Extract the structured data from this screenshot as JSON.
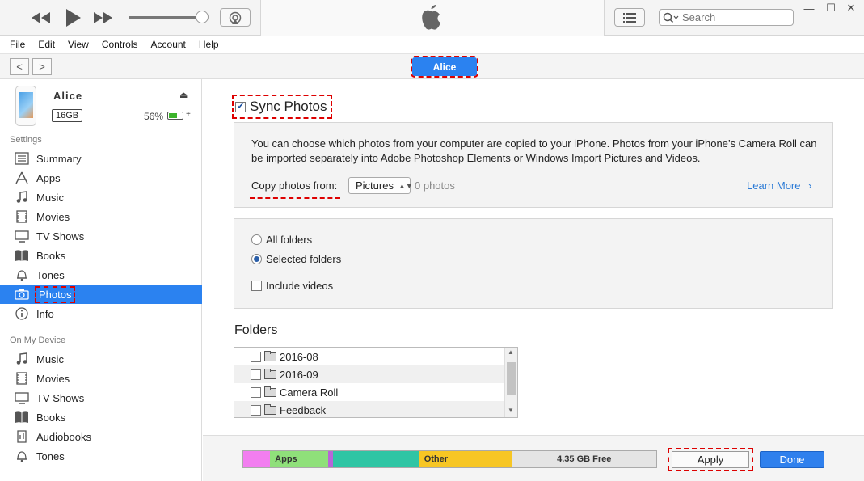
{
  "menu": [
    "File",
    "Edit",
    "View",
    "Controls",
    "Account",
    "Help"
  ],
  "search": {
    "placeholder": "Search"
  },
  "window_controls": {
    "minimize": "—",
    "maximize": "☐",
    "close": "✕"
  },
  "nav": {
    "back": "<",
    "forward": ">",
    "device_pill": "Alice"
  },
  "device": {
    "name": "Alice",
    "capacity": "16GB",
    "battery": "56%",
    "battery_level": 0.56
  },
  "sidebar": {
    "settings_header": "Settings",
    "settings_items": [
      {
        "label": "Summary",
        "icon": "summary-icon"
      },
      {
        "label": "Apps",
        "icon": "apps-icon"
      },
      {
        "label": "Music",
        "icon": "music-icon"
      },
      {
        "label": "Movies",
        "icon": "movies-icon"
      },
      {
        "label": "TV Shows",
        "icon": "tv-shows-icon"
      },
      {
        "label": "Books",
        "icon": "books-icon"
      },
      {
        "label": "Tones",
        "icon": "tones-icon"
      },
      {
        "label": "Photos",
        "icon": "camera-icon",
        "selected": true
      },
      {
        "label": "Info",
        "icon": "info-icon"
      }
    ],
    "device_header": "On My Device",
    "device_items": [
      {
        "label": "Music",
        "icon": "music-icon"
      },
      {
        "label": "Movies",
        "icon": "movies-icon"
      },
      {
        "label": "TV Shows",
        "icon": "tv-shows-icon"
      },
      {
        "label": "Books",
        "icon": "books-icon"
      },
      {
        "label": "Audiobooks",
        "icon": "audiobooks-icon"
      },
      {
        "label": "Tones",
        "icon": "tones-icon"
      }
    ]
  },
  "photos": {
    "sync_label": "Sync Photos",
    "sync_checked": true,
    "description": "You can choose which photos from your computer are copied to your iPhone. Photos from your iPhone’s Camera Roll can be imported separately into Adobe Photoshop Elements or Windows Import Pictures and Videos.",
    "copy_from_label": "Copy photos from:",
    "copy_from_value": "Pictures",
    "photo_count": "0 photos",
    "learn_more": "Learn More",
    "options": {
      "all_folders": "All folders",
      "selected_folders": "Selected folders",
      "include_videos": "Include videos",
      "selected": "selected_folders"
    },
    "folders_header": "Folders",
    "folders": [
      "2016-08",
      "2016-09",
      "Camera Roll",
      "Feedback"
    ]
  },
  "storage": {
    "segments": [
      {
        "label": "",
        "color": "#f27ef0",
        "share": 0.065
      },
      {
        "label": "Apps",
        "color": "#8fe07a",
        "share": 0.14
      },
      {
        "label": "",
        "color": "#b865d8",
        "share": 0.01
      },
      {
        "label": "",
        "color": "#2fc5a4",
        "share": 0.21
      },
      {
        "label": "Other",
        "color": "#f7c624",
        "share": 0.225
      },
      {
        "label": "4.35 GB Free",
        "color": "#e4e4e4",
        "share": 0.35
      }
    ]
  },
  "buttons": {
    "apply": "Apply",
    "done": "Done"
  }
}
